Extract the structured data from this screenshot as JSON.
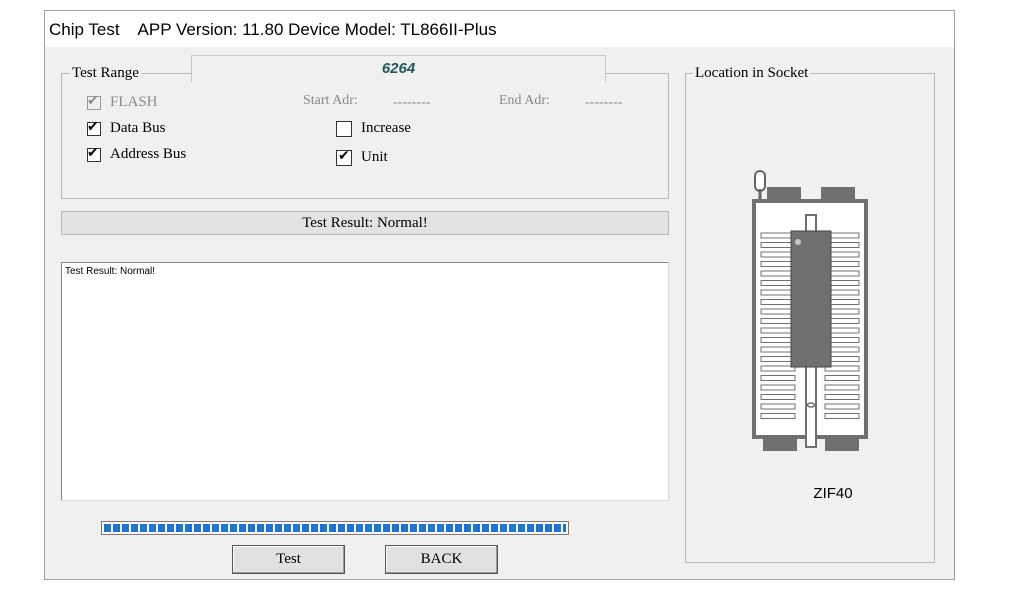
{
  "title_bar": {
    "app_name": "Chip Test",
    "version_label": "APP Version: 11.80 Device Model: TL866II-Plus"
  },
  "chip_name": "6264",
  "test_range": {
    "label": "Test Range",
    "flash_label": "FLASH",
    "flash_checked": true,
    "flash_enabled": false,
    "start_adr_label": "Start Adr:",
    "start_adr_value": "--------",
    "end_adr_label": "End Adr:",
    "end_adr_value": "--------",
    "data_bus_label": "Data Bus",
    "data_bus_checked": true,
    "address_bus_label": "Address Bus",
    "address_bus_checked": true,
    "increase_label": "Increase",
    "increase_checked": false,
    "unit_label": "Unit",
    "unit_checked": true
  },
  "result_header": "Test Result: Normal!",
  "log_text": "Test Result: Normal!",
  "progress_percent": 100,
  "buttons": {
    "test_label": "Test",
    "back_label": "BACK"
  },
  "socket": {
    "group_label": "Location in Socket",
    "socket_name": "ZIF40"
  },
  "colors": {
    "chip_name": "#1f5a5a",
    "progress": "#1e74d6",
    "chip_body": "#707070"
  }
}
